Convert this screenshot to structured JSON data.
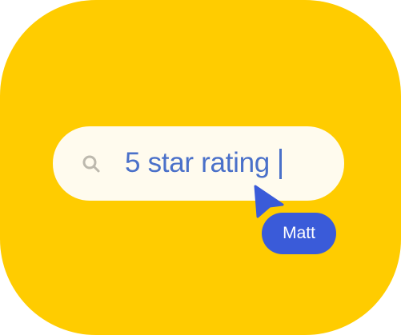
{
  "search": {
    "value": "5 star rating",
    "icon": "search-icon"
  },
  "cursor": {
    "user_name": "Matt",
    "icon": "pointer-cursor-icon"
  },
  "colors": {
    "background_card": "#FFCC00",
    "search_bar": "#FFFBEE",
    "search_text": "#4A70C9",
    "cursor_accent": "#3A5BD9"
  }
}
